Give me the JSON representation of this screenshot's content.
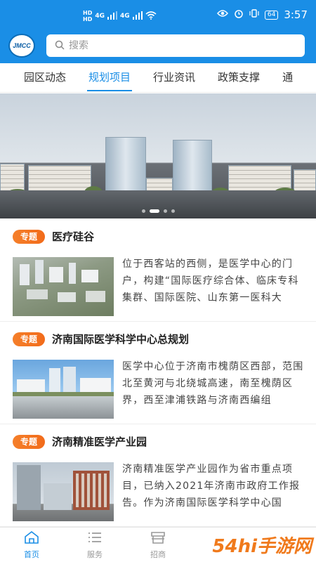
{
  "status_bar": {
    "hd1": "HD",
    "hd2": "HD",
    "net1": "4G",
    "net2": "4G",
    "battery": "64",
    "time": "3:57"
  },
  "header": {
    "logo_text": "JMCC",
    "search_placeholder": "搜索"
  },
  "tabs": [
    {
      "label": "园区动态",
      "active": false
    },
    {
      "label": "规划项目",
      "active": true
    },
    {
      "label": "行业资讯",
      "active": false
    },
    {
      "label": "政策支撑",
      "active": false
    },
    {
      "label": "通",
      "active": false
    }
  ],
  "banner": {
    "slide_count": 4,
    "active_slide": 1
  },
  "articles": [
    {
      "badge": "专题",
      "title": "医疗硅谷",
      "desc": "位于西客站的西侧，是医学中心的门户，构建“国际医疗综合体、临床专科集群、国际医院、山东第一医科大"
    },
    {
      "badge": "专题",
      "title": "济南国际医学科学中心总规划",
      "desc": "医学中心位于济南市槐荫区西部，范围北至黄河与北绕城高速，南至槐荫区界，西至津浦铁路与济南西编组"
    },
    {
      "badge": "专题",
      "title": "济南精准医学产业园",
      "desc": "济南精准医学产业园作为省市重点项目，已纳入2021年济南市政府工作报告。作为济南国际医学科学中心国"
    }
  ],
  "bottom_nav": [
    {
      "label": "首页",
      "icon": "home-icon",
      "active": true
    },
    {
      "label": "服务",
      "icon": "list-icon",
      "active": false
    },
    {
      "label": "招商",
      "icon": "store-icon",
      "active": false
    }
  ],
  "watermark": "54hi手游网",
  "colors": {
    "primary": "#1a8ee6",
    "badge": "#f26b1a",
    "inactive": "#999999"
  }
}
